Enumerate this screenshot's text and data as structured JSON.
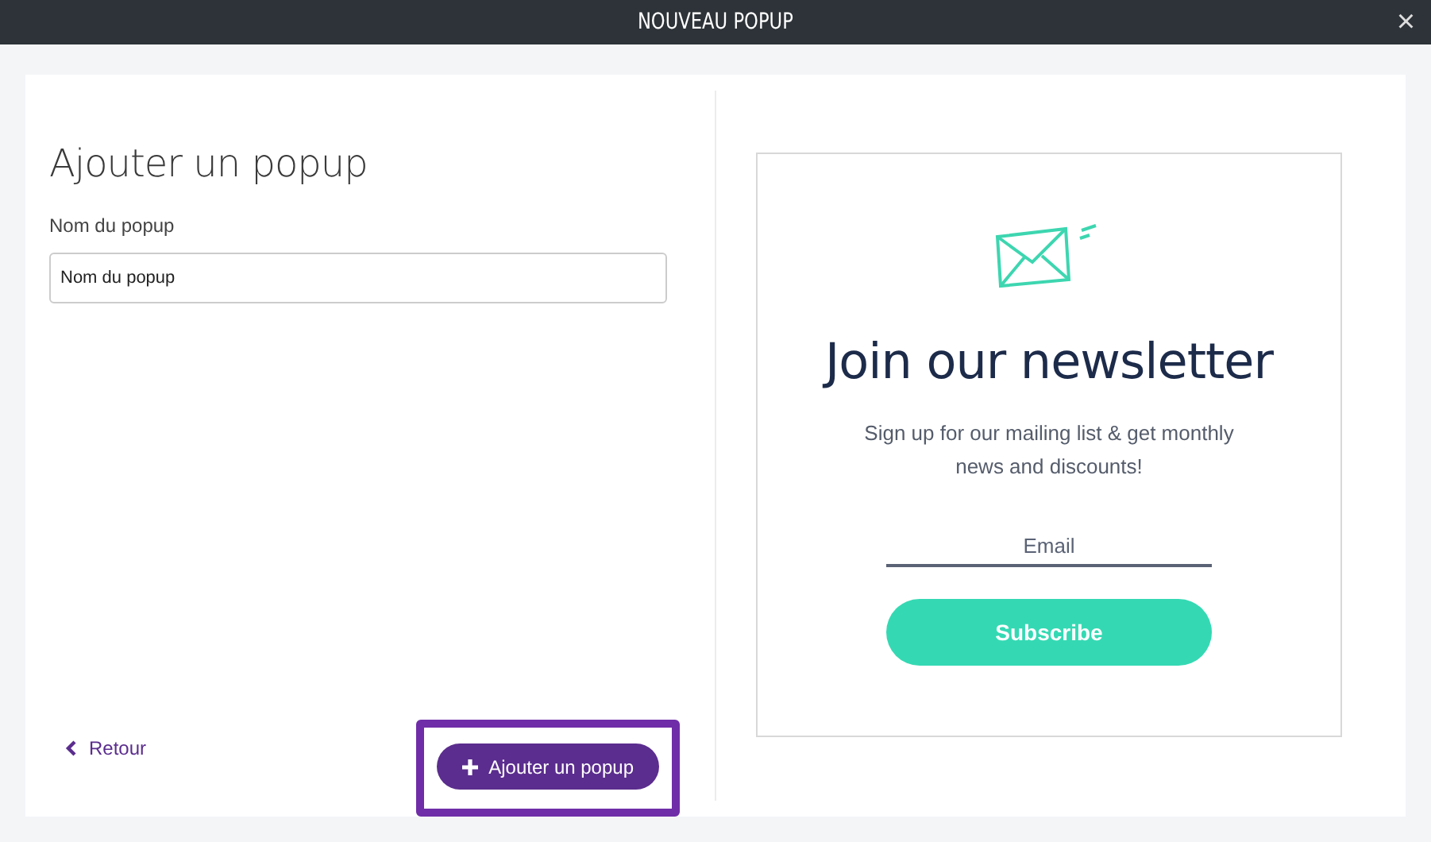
{
  "window": {
    "title": "NOUVEAU POPUP",
    "close": "×"
  },
  "form": {
    "heading": "Ajouter un popup",
    "name_label": "Nom du popup",
    "name_value": "Nom du popup",
    "back": "Retour",
    "submit": "Ajouter un popup",
    "submit_highlighted": true
  },
  "preview": {
    "title": "Join our newsletter",
    "text": "Sign up for our mailing list & get monthly news and discounts!",
    "email": {
      "placeholder": "Email"
    },
    "button": "Subscribe"
  }
}
